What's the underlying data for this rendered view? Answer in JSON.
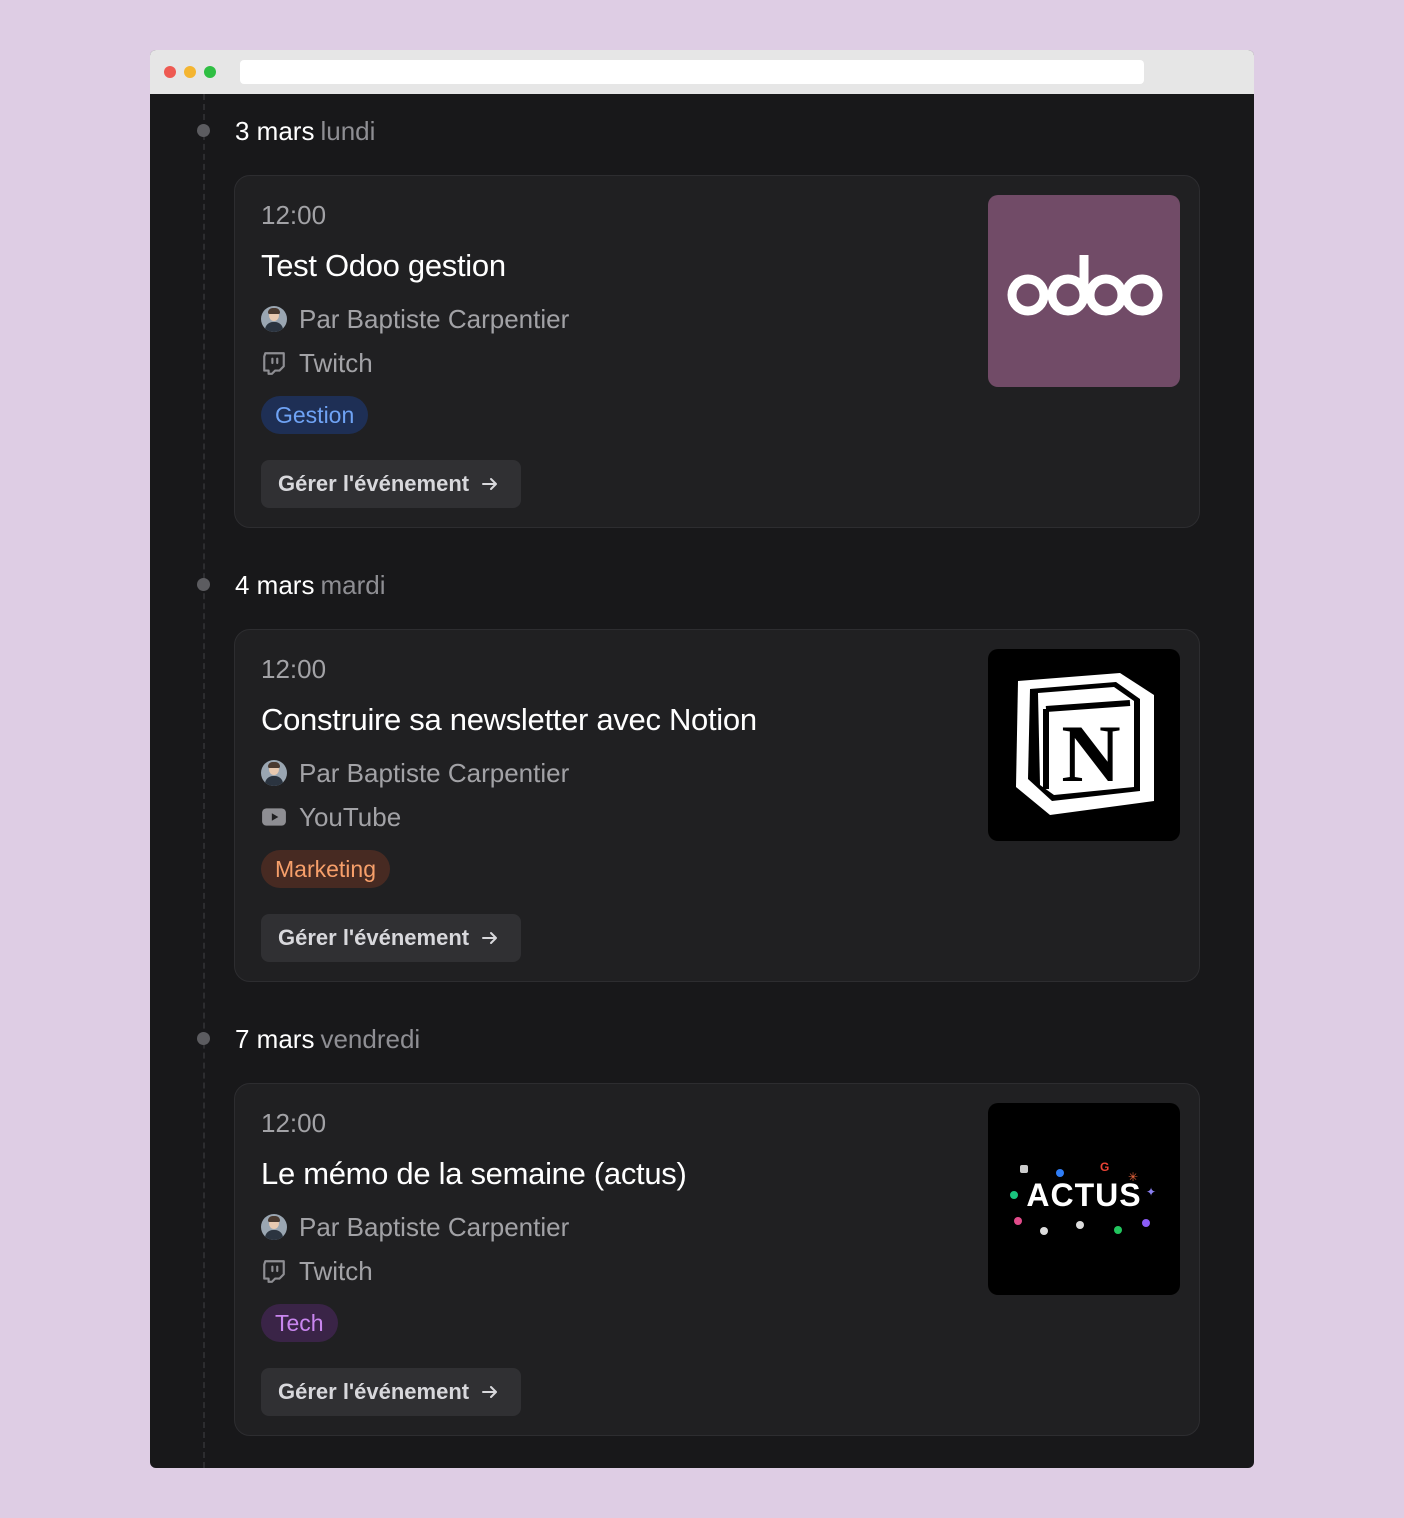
{
  "colors": {
    "page_background": "#decde4",
    "app_background": "#18181a",
    "card_background": "#202022",
    "tag_gestion": "#6fa3f5",
    "tag_marketing": "#f79f6a",
    "tag_tech": "#c986ef",
    "odoo_brand": "#714b67"
  },
  "events": [
    {
      "date": "3 mars",
      "weekday": "lundi",
      "time": "12:00",
      "title": "Test Odoo gestion",
      "author": "Par Baptiste Carpentier",
      "platform": "Twitch",
      "platform_icon": "twitch-icon",
      "tag": "Gestion",
      "button": "Gérer l'événement",
      "thumbnail": "odoo",
      "thumbnail_text": "odoo"
    },
    {
      "date": "4 mars",
      "weekday": "mardi",
      "time": "12:00",
      "title": "Construire sa newsletter avec Notion",
      "author": "Par Baptiste Carpentier",
      "platform": "YouTube",
      "platform_icon": "youtube-icon",
      "tag": "Marketing",
      "button": "Gérer l'événement",
      "thumbnail": "notion",
      "thumbnail_text": "N"
    },
    {
      "date": "7 mars",
      "weekday": "vendredi",
      "time": "12:00",
      "title": "Le mémo de la semaine (actus)",
      "author": "Par Baptiste Carpentier",
      "platform": "Twitch",
      "platform_icon": "twitch-icon",
      "tag": "Tech",
      "button": "Gérer l'événement",
      "thumbnail": "actus",
      "thumbnail_text": "ACTUS"
    }
  ]
}
